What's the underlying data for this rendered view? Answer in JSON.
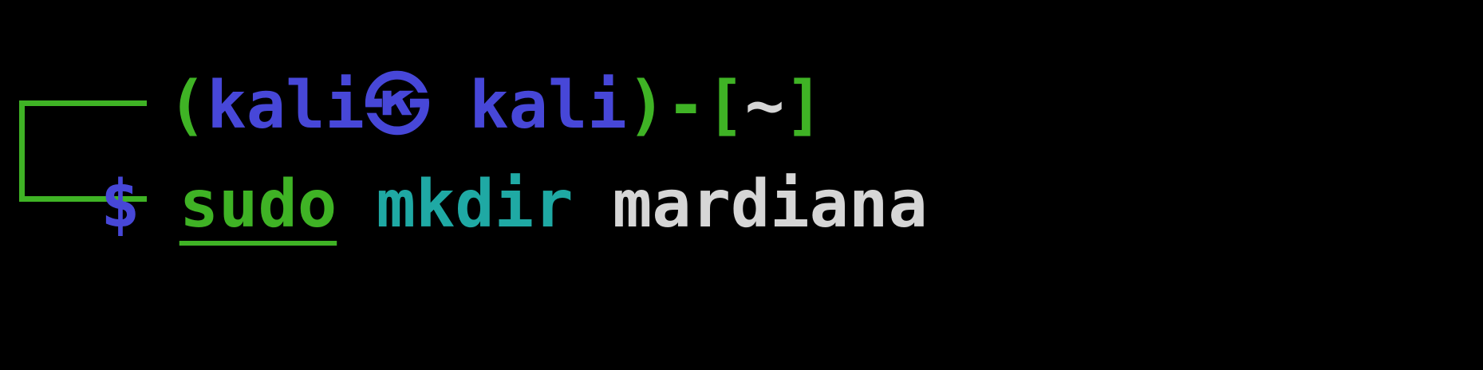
{
  "prompt": {
    "open_paren": "(",
    "user": "kali",
    "at_symbol": "㉿",
    "host": "kali",
    "close_paren": ")",
    "dash": "-",
    "dir_open": "[",
    "cwd": "~",
    "dir_close": "]",
    "symbol": "$"
  },
  "command": {
    "sudo": "sudo",
    "cmd": "mkdir",
    "arg": "mardiana"
  },
  "colors": {
    "background": "#000000",
    "prompt_box": "#3fb325",
    "user_host": "#4747d8",
    "cwd": "#d6d6d6",
    "sudo": "#3fb325",
    "cmd": "#1fa9a4",
    "arg": "#d6d6d6"
  }
}
